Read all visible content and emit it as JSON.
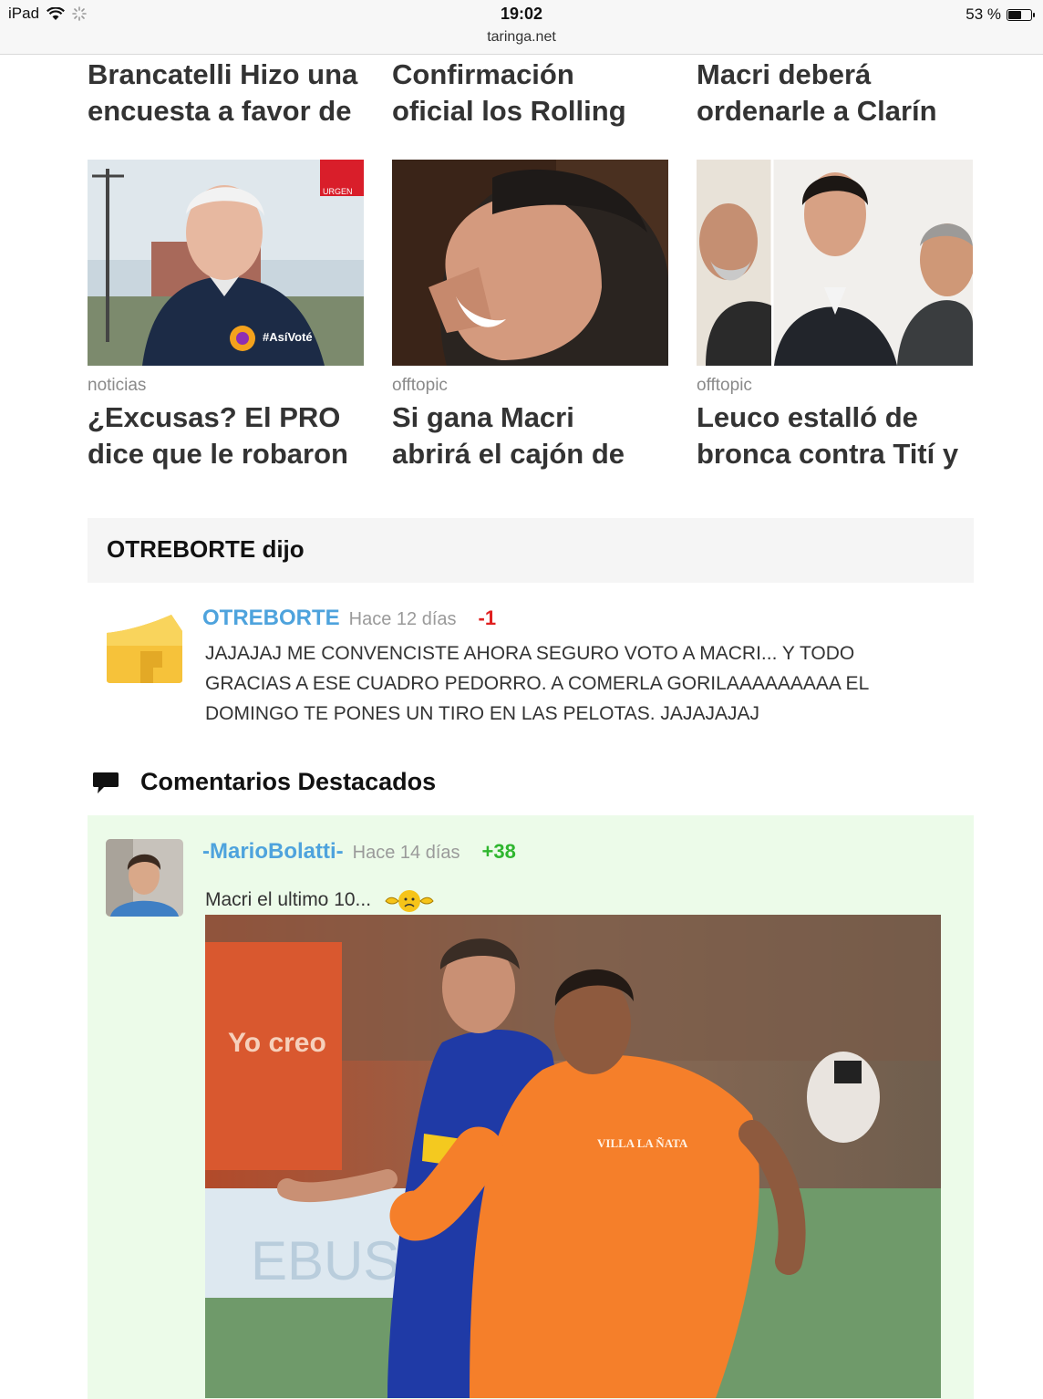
{
  "status_bar": {
    "device": "iPad",
    "time": "19:02",
    "url": "taringa.net",
    "battery_text": "53 %",
    "battery_level": 0.53
  },
  "top_titles": [
    {
      "line1": "Brancatelli Hizo una",
      "line2": "encuesta a favor de"
    },
    {
      "line1": "Confirmación",
      "line2": "oficial los Rolling"
    },
    {
      "line1": "Macri deberá",
      "line2": "ordenarle a Clarín"
    }
  ],
  "cards": [
    {
      "category": "noticias",
      "line1": "¿Excusas? El PRO",
      "line2": "dice que le robaron",
      "badge": "#AsíVoté",
      "tag": "URGEN"
    },
    {
      "category": "offtopic",
      "line1": "Si gana Macri",
      "line2": "abrirá el cajón de"
    },
    {
      "category": "offtopic",
      "line1": "Leuco estalló de",
      "line2": "bronca contra Tití y"
    }
  ],
  "quote": {
    "header": "OTREBORTE dijo",
    "user": "OTREBORTE",
    "time": "Hace 12 días",
    "score": "-1",
    "lines": [
      "JAJAJAJ ME CONVENCISTE AHORA SEGURO VOTO A MACRI... Y TODO",
      "GRACIAS A ESE CUADRO PEDORRO. A COMERLA GORILAAAAAAAAA EL",
      "DOMINGO TE PONES UN TIRO EN LAS PELOTAS. JAJAJAJAJ"
    ]
  },
  "featured": {
    "section_title": "Comentarios Destacados",
    "user": "-MarioBolatti-",
    "time": "Hace 14 días",
    "score": "+38",
    "text": "Macri el ultimo 10...",
    "photo_labels": {
      "shirt": "VILLA LA ÑATA",
      "banner": "Yo creo",
      "ad": "EBUS"
    }
  },
  "colors": {
    "username": "#4ea3dd",
    "negative": "#e02020",
    "positive": "#2fb62f",
    "featured_bg": "#ecfbe9"
  }
}
